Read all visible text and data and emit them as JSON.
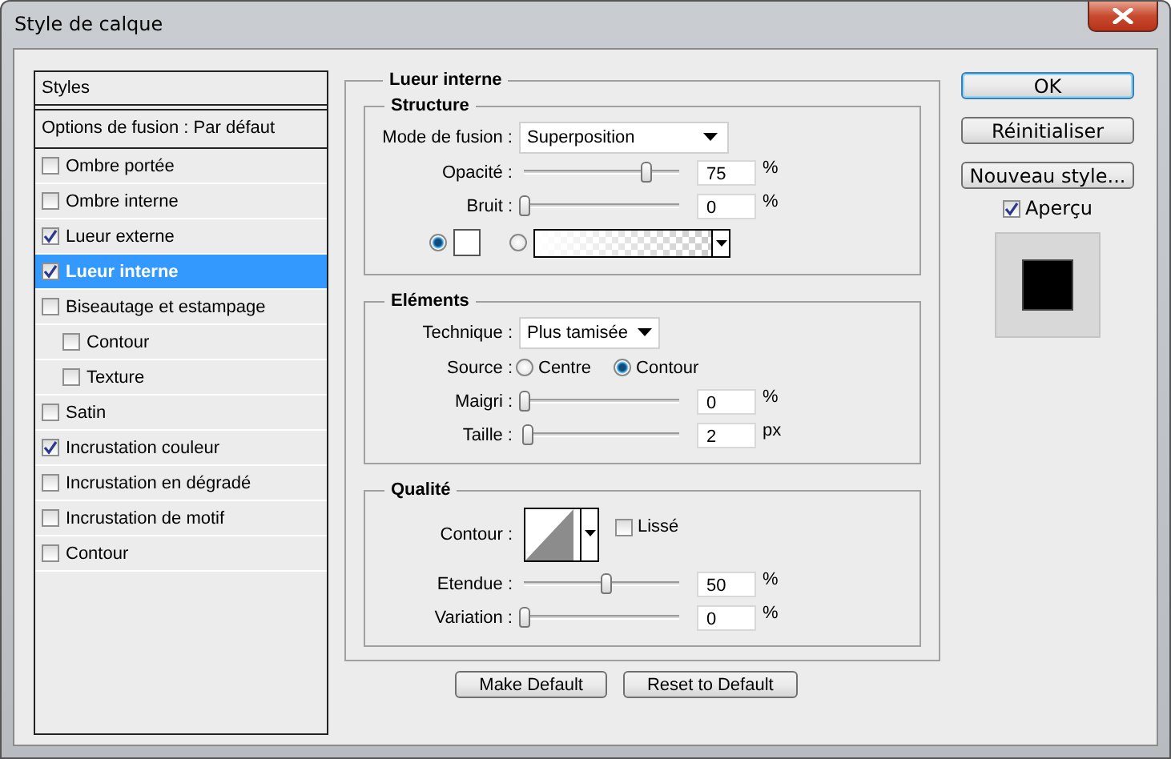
{
  "window": {
    "title": "Style de calque"
  },
  "styles": {
    "header": "Styles",
    "options": "Options de fusion : Par défaut",
    "items": [
      {
        "label": "Ombre portée",
        "checked": false,
        "selected": false
      },
      {
        "label": "Ombre interne",
        "checked": false,
        "selected": false
      },
      {
        "label": "Lueur externe",
        "checked": true,
        "selected": false
      },
      {
        "label": "Lueur interne",
        "checked": true,
        "selected": true
      },
      {
        "label": "Biseautage et estampage",
        "checked": false,
        "selected": false,
        "children": [
          {
            "label": "Contour",
            "checked": false,
            "selected": false
          },
          {
            "label": "Texture",
            "checked": false,
            "selected": false
          }
        ]
      },
      {
        "label": "Satin",
        "checked": false,
        "selected": false
      },
      {
        "label": "Incrustation couleur",
        "checked": true,
        "selected": false
      },
      {
        "label": "Incrustation en dégradé",
        "checked": false,
        "selected": false
      },
      {
        "label": "Incrustation de motif",
        "checked": false,
        "selected": false
      },
      {
        "label": "Contour",
        "checked": false,
        "selected": false
      }
    ]
  },
  "effect": {
    "title": "Lueur interne",
    "sections": [
      {
        "title": "Structure",
        "rows": [
          {
            "kind": "select",
            "label": "Mode de fusion :",
            "value": "Superposition"
          },
          {
            "kind": "slider",
            "label": "Opacité :",
            "level": 0.75,
            "value": "75",
            "unit": "%"
          },
          {
            "kind": "slider",
            "label": "Bruit :",
            "level": 0,
            "value": "0",
            "unit": "%"
          },
          {
            "kind": "fill",
            "options": [
              {
                "kind": "color",
                "selected": true
              },
              {
                "kind": "gradient",
                "selected": false
              }
            ]
          }
        ]
      },
      {
        "title": "Eléments",
        "rows": [
          {
            "kind": "select",
            "label": "Technique :",
            "value": "Plus tamisée"
          },
          {
            "kind": "radio",
            "label": "Source :",
            "options": [
              {
                "label": "Centre",
                "selected": false
              },
              {
                "label": "Contour",
                "selected": true
              }
            ]
          },
          {
            "kind": "slider",
            "label": "Maigri :",
            "level": 0,
            "value": "0",
            "unit": "%"
          },
          {
            "kind": "slider",
            "label": "Taille :",
            "level": 0.02,
            "value": "2",
            "unit": "px"
          }
        ]
      },
      {
        "title": "Qualité",
        "rows": [
          {
            "kind": "contour",
            "label": "Contour :",
            "check_label": "Lissé",
            "checked": false
          },
          {
            "kind": "slider",
            "label": "Etendue :",
            "level": 0.5,
            "value": "50",
            "unit": "%"
          },
          {
            "kind": "slider",
            "label": "Variation :",
            "level": 0,
            "value": "0",
            "unit": "%"
          }
        ]
      }
    ],
    "buttons": [
      "Make Default",
      "Reset to Default"
    ]
  },
  "actions": [
    {
      "label": "OK",
      "default": true
    },
    {
      "label": "Réinitialiser",
      "default": false
    },
    {
      "label": "Nouveau style...",
      "default": false
    }
  ],
  "preview": {
    "label": "Aperçu",
    "checked": true
  }
}
